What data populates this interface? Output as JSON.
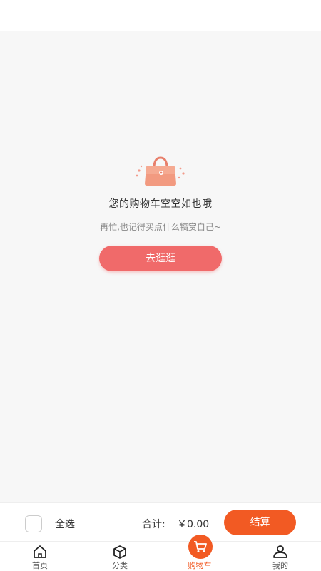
{
  "empty": {
    "title": "您的购物车空空如也哦",
    "subtitle": "再忙,也记得买点什么犒赏自己~",
    "button": "去逛逛"
  },
  "checkout": {
    "select_all": "全选",
    "total_label": "合计:",
    "total_value": "￥0.00",
    "button": "结算"
  },
  "tabs": [
    {
      "label": "首页",
      "icon": "home-icon"
    },
    {
      "label": "分类",
      "icon": "box-icon"
    },
    {
      "label": "购物车",
      "icon": "cart-icon",
      "active": true
    },
    {
      "label": "我的",
      "icon": "user-icon"
    }
  ],
  "colors": {
    "accent": "#f25a23",
    "empty_button": "#f06a6a",
    "background": "#f7f7f7"
  }
}
